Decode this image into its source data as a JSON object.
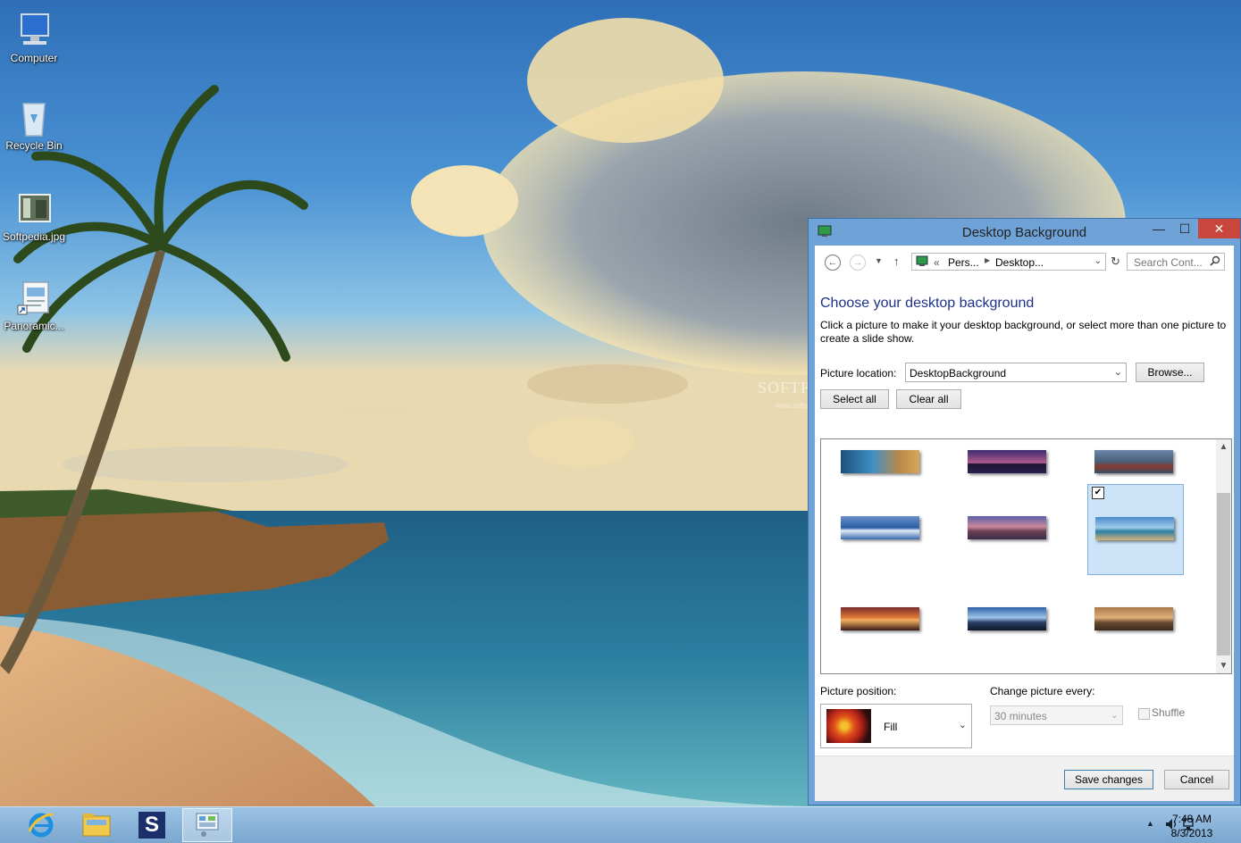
{
  "desktop": {
    "icons": [
      {
        "label": "Computer",
        "icon": "computer-icon"
      },
      {
        "label": "Recycle Bin",
        "icon": "recycle-bin-icon"
      },
      {
        "label": "Softpedia.jpg",
        "icon": "image-file-icon"
      },
      {
        "label": "Panoramic...",
        "icon": "shortcut-icon"
      }
    ],
    "watermark": "SOFTPEDIA",
    "watermark_sub": "www.softpedia.com"
  },
  "window": {
    "title": "Desktop Background",
    "controls": {
      "minimize": "—",
      "maximize": "☐",
      "close": "✕"
    },
    "nav": {
      "back": "←",
      "forward": "→",
      "up": "↑",
      "refresh": "↻",
      "breadcrumb_prefix": "«",
      "crumbs": [
        "Pers...",
        "Desktop..."
      ],
      "search_placeholder": "Search Cont..."
    },
    "heading": "Choose your desktop background",
    "description": "Click a picture to make it your desktop background, or select more than one picture to create a slide show.",
    "picture_location_label": "Picture location:",
    "picture_location_value": "DesktopBackground",
    "browse_label": "Browse...",
    "select_all_label": "Select all",
    "clear_all_label": "Clear all",
    "thumbnails": [
      {
        "theme": "coast-cliffs",
        "selected": false
      },
      {
        "theme": "purple-palms-sunset",
        "selected": false
      },
      {
        "theme": "mountain-lake",
        "selected": false
      },
      {
        "theme": "blue-waves",
        "selected": false
      },
      {
        "theme": "pink-dusk-beach",
        "selected": false
      },
      {
        "theme": "palm-beach",
        "selected": true
      },
      {
        "theme": "orange-sunset-pier",
        "selected": false
      },
      {
        "theme": "blue-sky-palm",
        "selected": false
      },
      {
        "theme": "amber-shore",
        "selected": false
      }
    ],
    "picture_position_label": "Picture position:",
    "picture_position_value": "Fill",
    "change_picture_label": "Change picture every:",
    "change_picture_value": "30 minutes",
    "shuffle_label": "Shuffle",
    "save_label": "Save changes",
    "cancel_label": "Cancel"
  },
  "taskbar": {
    "apps": [
      {
        "name": "internet-explorer",
        "icon": "internet-explorer-icon"
      },
      {
        "name": "file-explorer",
        "icon": "folder-icon"
      },
      {
        "name": "softpedia",
        "icon": "softpedia-icon",
        "glyph": "S"
      },
      {
        "name": "control-panel",
        "icon": "control-panel-icon"
      }
    ],
    "time": "7:48 AM",
    "date": "8/3/2013"
  }
}
